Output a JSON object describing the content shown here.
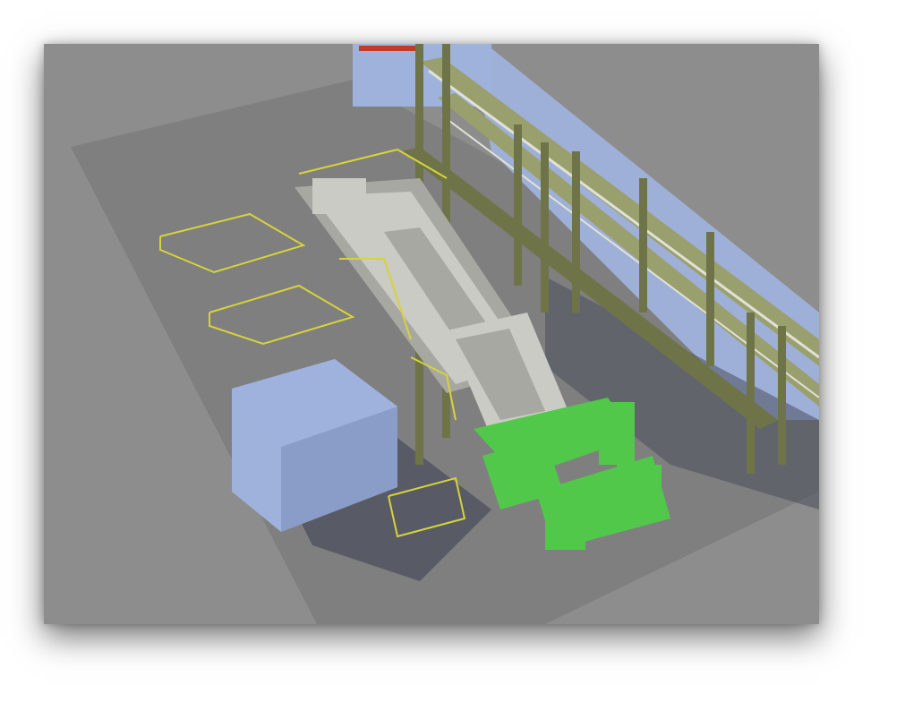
{
  "scene": {
    "subject": "",
    "colors": {
      "ground": "#8d8d8d",
      "floor_slab": "#7f7f7f",
      "shadow": "#4b4f5c",
      "building": "#9fb2dc",
      "building_side": "#8a9cc8",
      "steel_column": "#6f7448",
      "steel_light": "#9a9f6e",
      "machinery_light": "#c9cbc4",
      "machinery_mid": "#a6a8a1",
      "machinery_green": "#52c84a",
      "railing_yellow": "#d7d33a",
      "accent_red": "#c0392b",
      "back_wall": "#9fb0d8"
    }
  }
}
